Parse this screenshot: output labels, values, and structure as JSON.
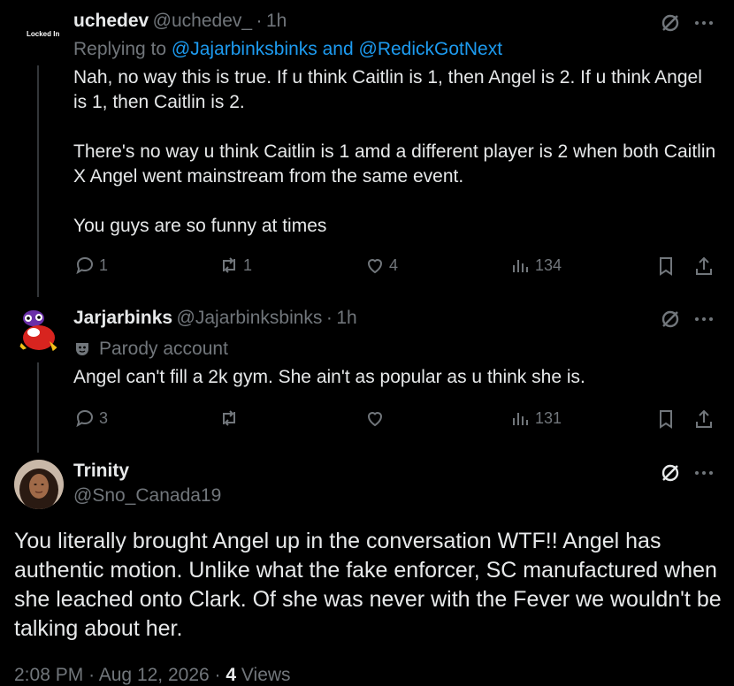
{
  "tweets": [
    {
      "avatar_label": "Locked In",
      "name": "uchedev",
      "handle": "@uchedev_",
      "time": "1h",
      "replying_prefix": "Replying to",
      "replying_to": "@Jajarbinksbinks and @RedickGotNext",
      "paragraphs": [
        "Nah, no way this is true. If u think Caitlin is 1, then Angel is 2. If u think Angel is 1, then Caitlin is 2.",
        "There's no way u think Caitlin is 1 amd a different player is 2 when both Caitlin X Angel went mainstream from the same event.",
        "You guys are so funny at times"
      ],
      "replies": "1",
      "reposts": "1",
      "likes": "4",
      "views": "134"
    },
    {
      "name": "Jarjarbinks",
      "handle": "@Jajarbinksbinks",
      "time": "1h",
      "parody_label": "Parody account",
      "text": "Angel can't fill a 2k gym. She ain't as popular as u think she is.",
      "replies": "3",
      "reposts": "",
      "likes": "",
      "views": "131"
    }
  ],
  "main_tweet": {
    "name": "Trinity",
    "handle": "@Sno_Canada19",
    "text": "You literally brought Angel up in the conversation WTF!! Angel has authentic motion. Unlike what the fake enforcer, SC manufactured when she leached onto Clark. Of she was never with the Fever we wouldn't be talking about her.",
    "time": "2:08 PM",
    "date": "Aug 12, 2026",
    "views_count": "4",
    "views_label": "Views",
    "sep": "·"
  },
  "icons": {
    "reply": "reply-icon",
    "repost": "repost-icon",
    "like": "heart-icon",
    "views": "views-icon",
    "bookmark": "bookmark-icon",
    "share": "share-icon",
    "grok": "grok-icon",
    "more": "more-icon"
  },
  "colors": {
    "background": "#000000",
    "text": "#e7e9ea",
    "muted": "#71767b",
    "link": "#1d9bf0"
  }
}
